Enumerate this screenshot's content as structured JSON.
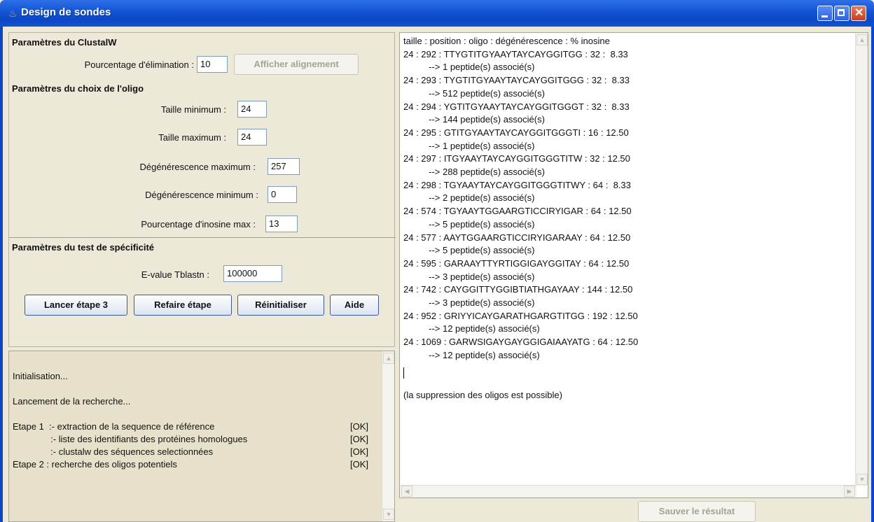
{
  "window": {
    "title": "Design de sondes"
  },
  "clustalw": {
    "heading": "Paramètres du ClustalW",
    "elimination_label": "Pourcentage d'élimination :",
    "elimination_value": "10",
    "show_alignment_button": "Afficher alignement"
  },
  "oligo": {
    "heading": "Paramètres du choix de l'oligo",
    "min_size_label": "Taille minimum :",
    "min_size_value": "24",
    "max_size_label": "Taille maximum :",
    "max_size_value": "24",
    "max_degeneracy_label": "Dégénérescence maximum :",
    "max_degeneracy_value": "257",
    "min_degeneracy_label": "Dégénérescence minimum :",
    "min_degeneracy_value": "0",
    "max_inosine_label": "Pourcentage d'inosine max :",
    "max_inosine_value": "13"
  },
  "specificity": {
    "heading": "Paramètres du test de spécificité",
    "evalue_label": "E-value Tblastn :",
    "evalue_value": "100000"
  },
  "actions": {
    "run": "Lancer étape 3",
    "redo": "Refaire étape",
    "reset": "Réinitialiser",
    "help": "Aide"
  },
  "log": {
    "lines": [
      "Initialisation...",
      "Lancement de la recherche...",
      "Etape 1  :- extraction de la sequence de référence",
      "               :- liste des identifiants des protéines homologues",
      "               :- clustalw des séquences selectionnées",
      "Etape 2 : recherche des oligos potentiels"
    ],
    "status": [
      "[OK]",
      "[OK]",
      "[OK]",
      "[OK]"
    ]
  },
  "results": {
    "lines": [
      "taille : position : oligo : dégénérescence : % inosine",
      "24 : 292 : TTYGTITGYAAYTAYCAYGGITGG : 32 :  8.33",
      "          --> 1 peptide(s) associé(s)",
      "24 : 293 : TYGTITGYAAYTAYCAYGGITGGG : 32 :  8.33",
      "          --> 512 peptide(s) associé(s)",
      "24 : 294 : YGTITGYAAYTAYCAYGGITGGGT : 32 :  8.33",
      "          --> 144 peptide(s) associé(s)",
      "24 : 295 : GTITGYAAYTAYCAYGGITGGGTI : 16 : 12.50",
      "          --> 1 peptide(s) associé(s)",
      "24 : 297 : ITGYAAYTAYCAYGGITGGGTITW : 32 : 12.50",
      "          --> 288 peptide(s) associé(s)",
      "24 : 298 : TGYAAYTAYCAYGGITGGGTITWY : 64 :  8.33",
      "          --> 2 peptide(s) associé(s)",
      "24 : 574 : TGYAAYTGGAARGTICCIRYIGAR : 64 : 12.50",
      "          --> 5 peptide(s) associé(s)",
      "24 : 577 : AAYTGGAARGTICCIRYIGARAAY : 64 : 12.50",
      "          --> 5 peptide(s) associé(s)",
      "24 : 595 : GARAAYTTYRTIGGIGAYGGITAY : 64 : 12.50",
      "          --> 3 peptide(s) associé(s)",
      "24 : 742 : CAYGGITTYGGIBTIATHGAYAAY : 144 : 12.50",
      "          --> 3 peptide(s) associé(s)",
      "24 : 952 : GRIYYICAYGARATHGARGTITGG : 192 : 12.50",
      "          --> 12 peptide(s) associé(s)",
      "24 : 1069 : GARWSIGAYGAYGGIGAIAAYATG : 64 : 12.50",
      "          --> 12 peptide(s) associé(s)"
    ],
    "note": "(la suppression des oligos est possible)",
    "save_button": "Sauver le résultat"
  }
}
